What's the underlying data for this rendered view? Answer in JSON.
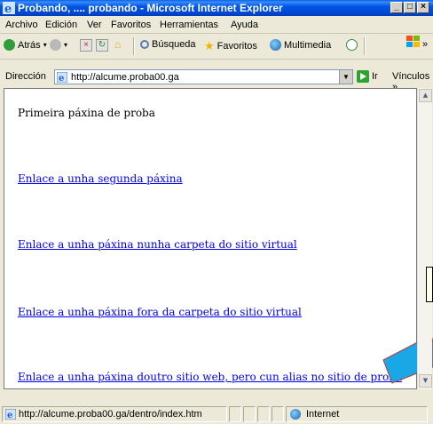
{
  "window": {
    "title": "Probando, .... probando - Microsoft Internet Explorer"
  },
  "title_buttons": {
    "minimize": "_",
    "maximize": "□",
    "close": "×"
  },
  "menubar": {
    "items": [
      {
        "label": "Archivo"
      },
      {
        "label": "Edición"
      },
      {
        "label": "Ver"
      },
      {
        "label": "Favoritos"
      },
      {
        "label": "Herramientas"
      },
      {
        "label": "Ayuda"
      }
    ]
  },
  "toolbar": {
    "back_label": "Atrás",
    "search_label": "Búsqueda",
    "favorites_label": "Favoritos",
    "multimedia_label": "Multimedia",
    "more": "»"
  },
  "addressbar": {
    "label": "Dirección",
    "url": "http://alcume.proba00.ga",
    "go_label": "Ir",
    "links_label": "Vínculos »"
  },
  "page": {
    "heading": "Primeira páxina de proba",
    "links": [
      {
        "text": "Enlace a unha segunda páxina"
      },
      {
        "text": "Enlace a unha páxina nunha carpeta do sitio virtual"
      },
      {
        "text": "Enlace a unha páxina fora da carpeta do sitio virtual"
      },
      {
        "text": "Enlace a unha páxina doutro sitio web, pero cun alias no sitio de proba"
      }
    ]
  },
  "statusbar": {
    "url": "http://alcume.proba00.ga/dentro/index.htm",
    "zone": "Internet"
  },
  "colors": {
    "titlebar": "#0055e5",
    "link": "#0000ee",
    "annotation_arrow": "#1aa7e8"
  }
}
